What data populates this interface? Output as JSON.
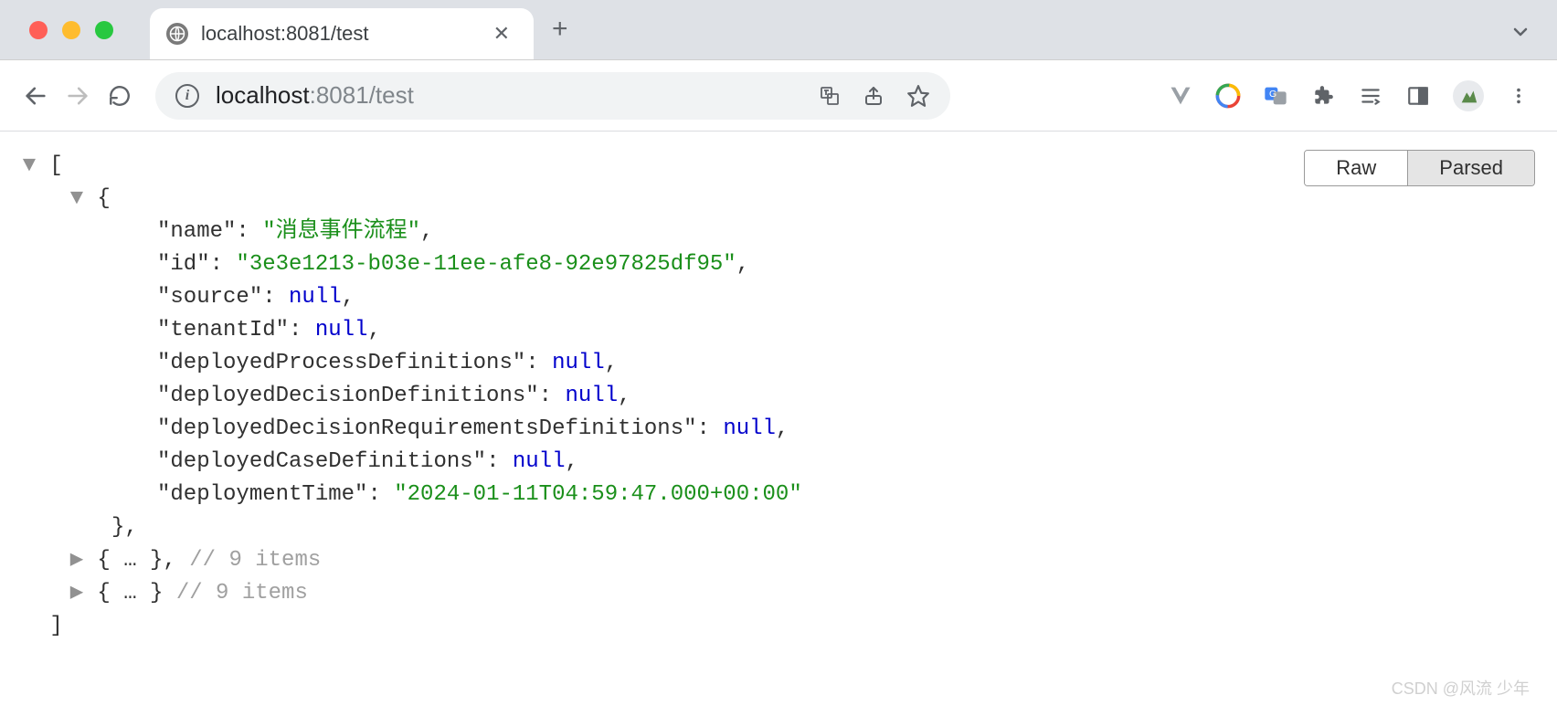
{
  "tab": {
    "title": "localhost:8081/test"
  },
  "addr": {
    "host": "localhost",
    "port_path": ":8081/test"
  },
  "view_toggle": {
    "raw": "Raw",
    "parsed": "Parsed"
  },
  "json": {
    "object": {
      "name": {
        "key": "\"name\"",
        "value": "\"消息事件流程\"",
        "type": "str",
        "trail": ","
      },
      "id": {
        "key": "\"id\"",
        "value": "\"3e3e1213-b03e-11ee-afe8-92e97825df95\"",
        "type": "str",
        "trail": ","
      },
      "source": {
        "key": "\"source\"",
        "value": "null",
        "type": "nul",
        "trail": ","
      },
      "tenantId": {
        "key": "\"tenantId\"",
        "value": "null",
        "type": "nul",
        "trail": ","
      },
      "dpd": {
        "key": "\"deployedProcessDefinitions\"",
        "value": "null",
        "type": "nul",
        "trail": ","
      },
      "ddd": {
        "key": "\"deployedDecisionDefinitions\"",
        "value": "null",
        "type": "nul",
        "trail": ","
      },
      "ddrd": {
        "key": "\"deployedDecisionRequirementsDefinitions\"",
        "value": "null",
        "type": "nul",
        "trail": ","
      },
      "dcd": {
        "key": "\"deployedCaseDefinitions\"",
        "value": "null",
        "type": "nul",
        "trail": ","
      },
      "dtime": {
        "key": "\"deploymentTime\"",
        "value": "\"2024-01-11T04:59:47.000+00:00\"",
        "type": "str",
        "trail": ""
      }
    },
    "collapsed1": {
      "body": "{ … },",
      "comment": " // 9 items"
    },
    "collapsed2": {
      "body": "{ … }",
      "comment": " // 9 items"
    }
  },
  "watermark": "CSDN @风流 少年"
}
